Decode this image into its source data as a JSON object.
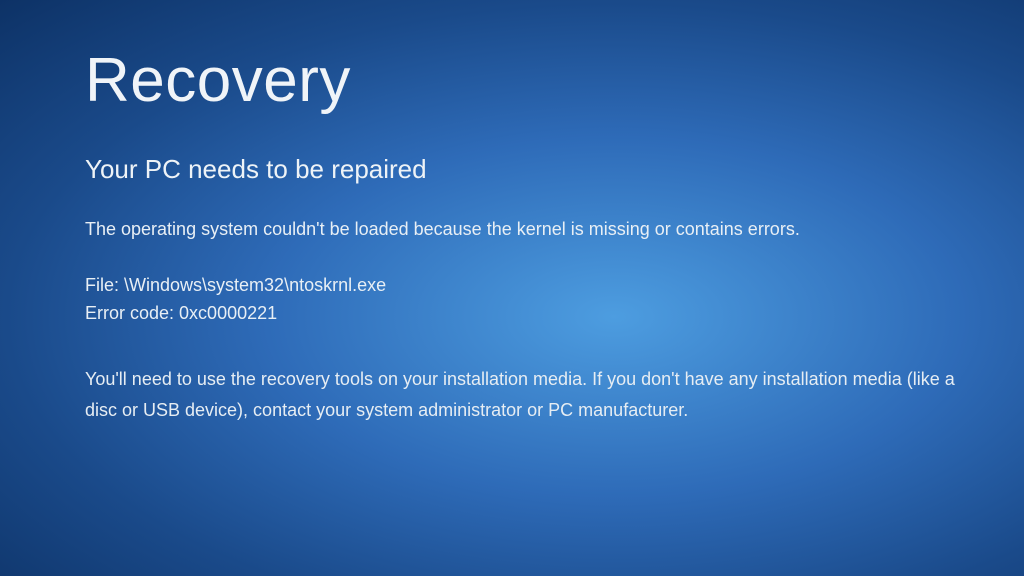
{
  "recovery": {
    "title": "Recovery",
    "subtitle": "Your PC needs to be repaired",
    "description": "The operating system couldn't be loaded because the kernel is missing or contains errors.",
    "file_label": "File: ",
    "file_path": "\\Windows\\system32\\ntoskrnl.exe",
    "error_label": "Error code: ",
    "error_code": "0xc0000221",
    "instructions": "You'll need to use the recovery tools on your installation media. If you don't have any installation media (like a disc or USB device), contact your system administrator or PC manufacturer."
  }
}
